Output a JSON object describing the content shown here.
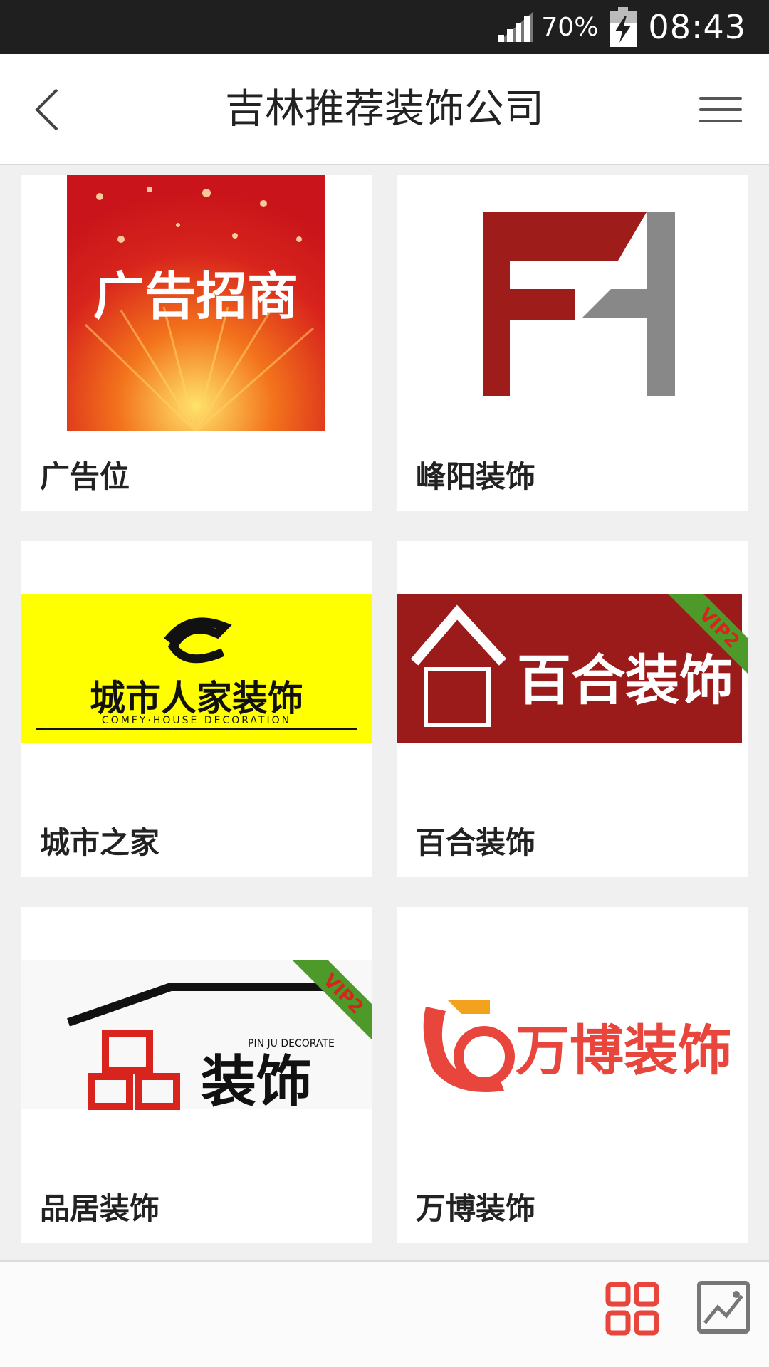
{
  "status_bar": {
    "battery_percent": "70%",
    "time": "08:43"
  },
  "header": {
    "title": "吉林推荐装饰公司"
  },
  "companies": [
    {
      "label": "广告位",
      "logo_text": "广告招商",
      "vip": ""
    },
    {
      "label": "峰阳装饰",
      "logo_text": "",
      "vip": ""
    },
    {
      "label": "城市之家",
      "logo_text": "城市人家装饰",
      "logo_subtext": "COMFY·HOUSE DECORATION",
      "vip": ""
    },
    {
      "label": "百合装饰",
      "logo_text": "百合装饰",
      "vip": "VIP2"
    },
    {
      "label": "品居装饰",
      "logo_text": "装饰",
      "logo_subtext": "PIN JU DECORATE",
      "vip": "VIP2"
    },
    {
      "label": "万博装饰",
      "logo_text": "万博装饰",
      "vip": ""
    }
  ],
  "colors": {
    "accent": "#e8453c",
    "status_bar": "#1f1f1f",
    "ad_red": "#d8241c",
    "feng_red": "#9e1d1a",
    "baihe_bg": "#9b1b1b",
    "chengshi_yellow": "#ffff00",
    "vip_green": "#4d9a2b"
  },
  "icons": {
    "back": "chevron-left-icon",
    "menu": "hamburger-menu-icon",
    "grid": "grid-view-icon",
    "image": "image-view-icon"
  }
}
